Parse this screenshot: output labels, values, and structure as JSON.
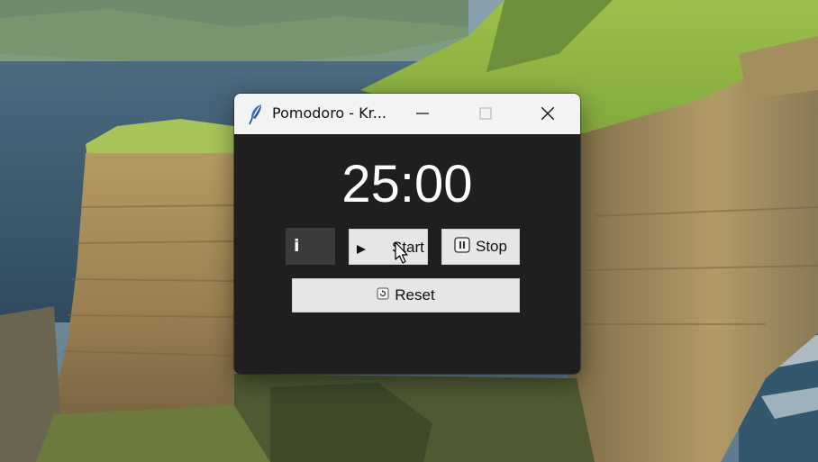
{
  "window": {
    "title": "Pomodoro - Kr..."
  },
  "timer": {
    "display": "25:00"
  },
  "controls": {
    "info_label": "i",
    "start_label": "Start",
    "stop_label": "Stop",
    "reset_label": "Reset"
  },
  "icons": {
    "app": "feather-icon",
    "minimize": "minimize-icon",
    "maximize": "maximize-icon",
    "close": "close-icon",
    "start": "play-icon",
    "stop": "pause-icon",
    "reset": "reset-icon"
  },
  "colors": {
    "window_bg": "#1f1f1f",
    "titlebar_bg": "#f3f3f3",
    "button_bg": "#e6e6e6",
    "info_bg": "#3b3b3b",
    "timer_text": "#ffffff"
  }
}
